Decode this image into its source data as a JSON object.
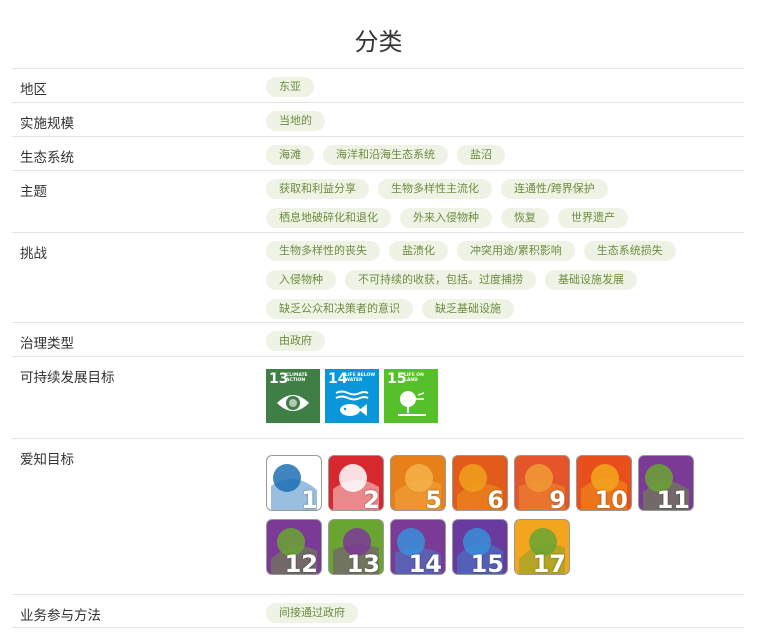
{
  "page_title": "分类",
  "rows": {
    "region": {
      "label": "地区",
      "tags": [
        "东亚"
      ]
    },
    "scale": {
      "label": "实施规模",
      "tags": [
        "当地的"
      ]
    },
    "ecosystem": {
      "label": "生态系统",
      "tags": [
        "海滩",
        "海洋和沿海生态系统",
        "盐沼"
      ]
    },
    "theme": {
      "label": "主题",
      "tags": [
        "获取和利益分享",
        "生物多样性主流化",
        "连通性/跨界保护",
        "栖息地破碎化和退化",
        "外来入侵物种",
        "恢复",
        "世界遗产"
      ]
    },
    "challenges": {
      "label": "挑战",
      "tags": [
        "生物多样性的丧失",
        "盐渍化",
        "冲突用途/累积影响",
        "生态系统损失",
        "入侵物种",
        "不可持续的收获，包括。过度捕捞",
        "基础设施发展",
        "缺乏公众和决策者的意识",
        "缺乏基础设施"
      ]
    },
    "governance": {
      "label": "治理类型",
      "tags": [
        "由政府"
      ]
    },
    "sdg": {
      "label": "可持续发展目标",
      "goals": [
        {
          "number": "13",
          "text": "CLIMATE ACTION",
          "color": "#3f7e44",
          "icon": "eye-globe-icon"
        },
        {
          "number": "14",
          "text": "LIFE BELOW WATER",
          "color": "#0a97d9",
          "icon": "fish-icon"
        },
        {
          "number": "15",
          "text": "LIFE ON LAND",
          "color": "#56c02b",
          "icon": "tree-icon"
        }
      ]
    },
    "aichi": {
      "label": "爱知目标",
      "targets": [
        {
          "number": "1",
          "color": "#ffffff",
          "accent": "#1f6fb5",
          "icon": "faces-icon"
        },
        {
          "number": "2",
          "color": "#d7282f",
          "accent": "#ffffff",
          "icon": "tree-circle-icon"
        },
        {
          "number": "5",
          "color": "#e8801a",
          "accent": "#f4b24a",
          "icon": "trees-icon"
        },
        {
          "number": "6",
          "color": "#e35b1a",
          "accent": "#f0a020",
          "icon": "fish-icon"
        },
        {
          "number": "9",
          "color": "#e4562a",
          "accent": "#f09a35",
          "icon": "footprints-icon"
        },
        {
          "number": "10",
          "color": "#e84f1c",
          "accent": "#f2a41d",
          "icon": "coral-icon"
        },
        {
          "number": "11",
          "color": "#7b3a96",
          "accent": "#6aa532",
          "icon": "fence-icon"
        },
        {
          "number": "12",
          "color": "#7b3a96",
          "accent": "#6aa532",
          "icon": "bear-icon"
        },
        {
          "number": "13",
          "color": "#6aa532",
          "accent": "#7b3a96",
          "icon": "wheat-icon"
        },
        {
          "number": "14",
          "color": "#7b3a96",
          "accent": "#3a8fd8",
          "icon": "drop-icon"
        },
        {
          "number": "15",
          "color": "#6a3b9e",
          "accent": "#3a8fd8",
          "icon": "molecule-icon"
        },
        {
          "number": "17",
          "color": "#f2a51d",
          "accent": "#6aa532",
          "icon": "people-icon"
        }
      ]
    },
    "engagement": {
      "label": "业务参与方法",
      "tags": [
        "间接通过政府"
      ]
    }
  }
}
